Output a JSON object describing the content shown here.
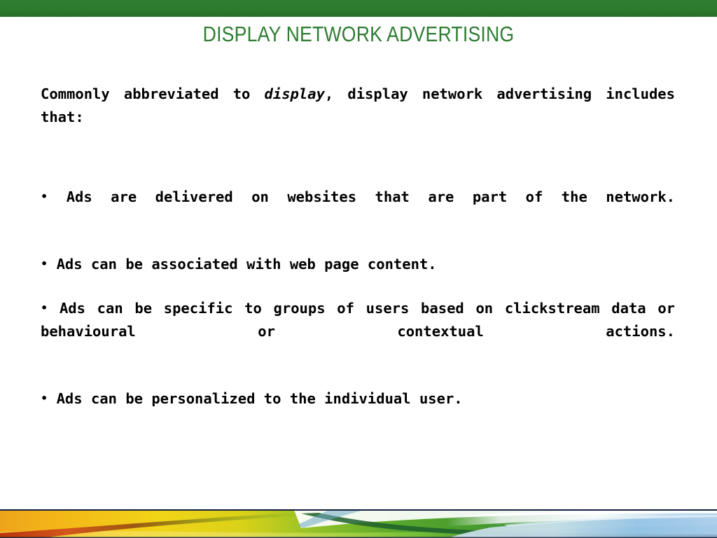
{
  "slide": {
    "title": "DISPLAY NETWORK ADVERTISING",
    "intro": {
      "lead": "Commonly abbreviated to ",
      "emphasis": "display",
      "tail": ", display network advertising includes that:"
    },
    "bullet_char": "•",
    "bullets": [
      {
        "text": "Ads are delivered on websites that are part of the network.",
        "justified": true
      },
      {
        "text": "Ads can be associated with web page content.",
        "justified": false
      },
      {
        "text": "Ads can be specific to groups of users based on clickstream data or behavioural or contextual actions.",
        "justified": true
      },
      {
        "text": "Ads can be personalized to the individual user.",
        "justified": false
      }
    ]
  },
  "theme": {
    "top_band_green": "#2c7a2e",
    "title_green": "#2e7d32",
    "body_text": "#000000",
    "background": "#ffffff",
    "footer_orange": "#f0a81e",
    "footer_yellow": "#f2d417",
    "footer_red": "#c43c12",
    "footer_green": "#4ea32a",
    "footer_dark_green": "#1c5a2a",
    "footer_blue": "#7cb6e0",
    "footer_light_blue": "#bcd9ef",
    "footer_edge_dark": "#12204a"
  }
}
